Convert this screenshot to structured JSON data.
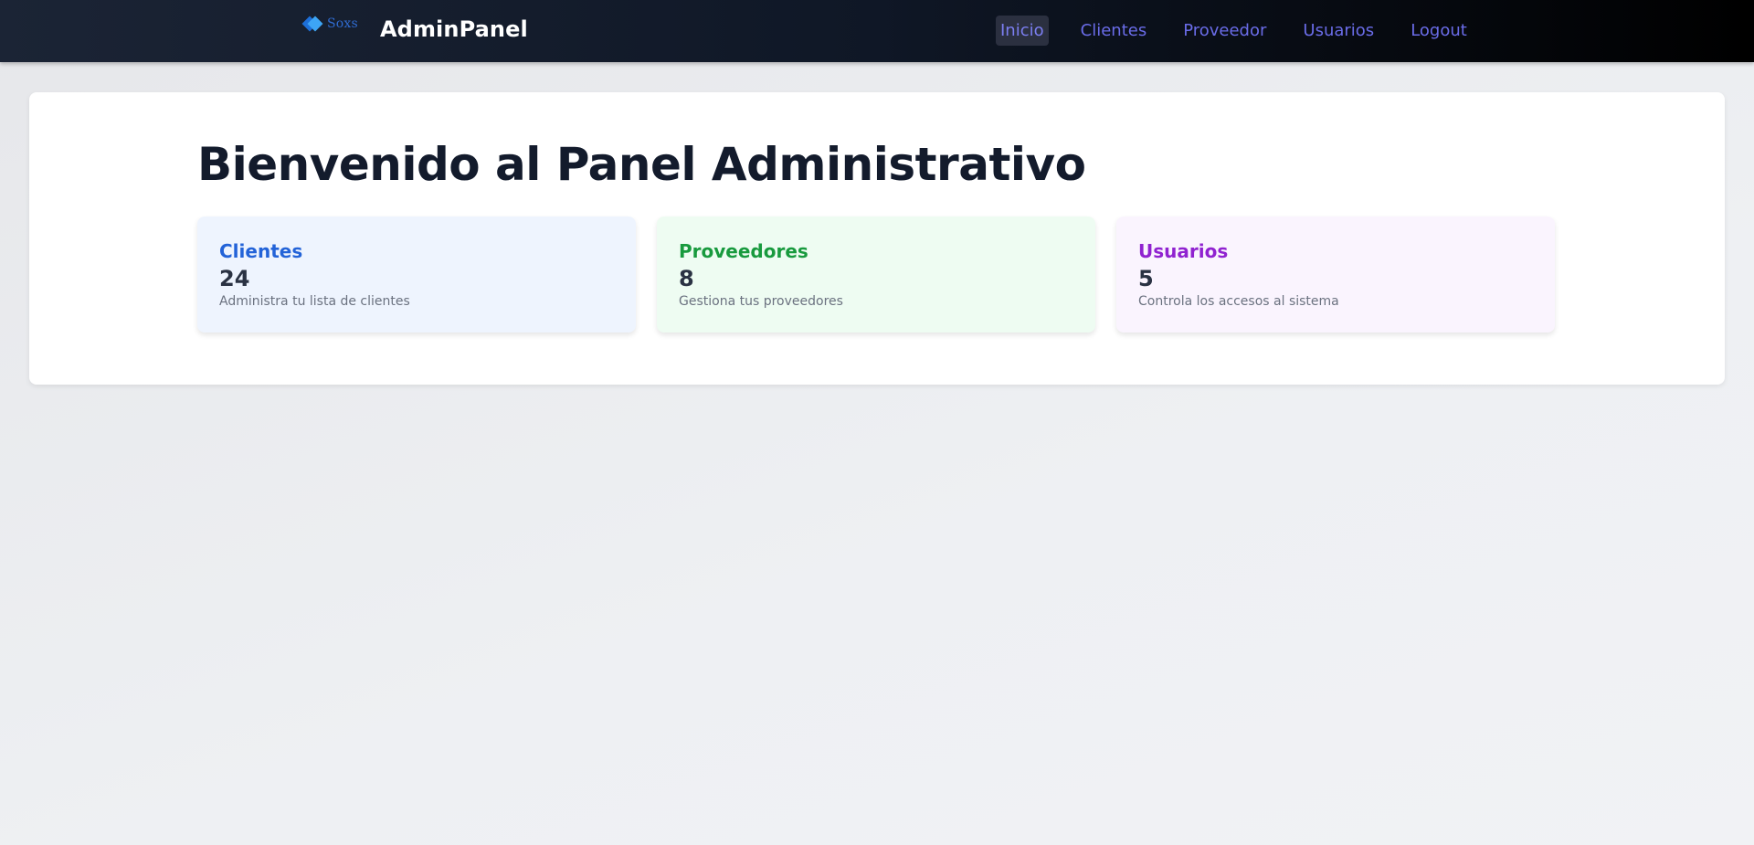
{
  "header": {
    "logo_text": "Soxs",
    "brand": "AdminPanel",
    "nav": [
      {
        "label": "Inicio",
        "active": true
      },
      {
        "label": "Clientes",
        "active": false
      },
      {
        "label": "Proveedor",
        "active": false
      },
      {
        "label": "Usuarios",
        "active": false
      },
      {
        "label": "Logout",
        "active": false
      }
    ]
  },
  "main": {
    "title": "Bienvenido al Panel Administrativo",
    "cards": [
      {
        "title": "Clientes",
        "count": "24",
        "description": "Administra tu lista de clientes",
        "color": "#2363d8"
      },
      {
        "title": "Proveedores",
        "count": "8",
        "description": "Gestiona tus proveedores",
        "color": "#189a3e"
      },
      {
        "title": "Usuarios",
        "count": "5",
        "description": "Controla los accesos al sistema",
        "color": "#9022d0"
      }
    ]
  },
  "colors": {
    "nav_link": "#6a6ce8",
    "navbar_bg_start": "#1b2435",
    "navbar_bg_end": "#000000"
  }
}
